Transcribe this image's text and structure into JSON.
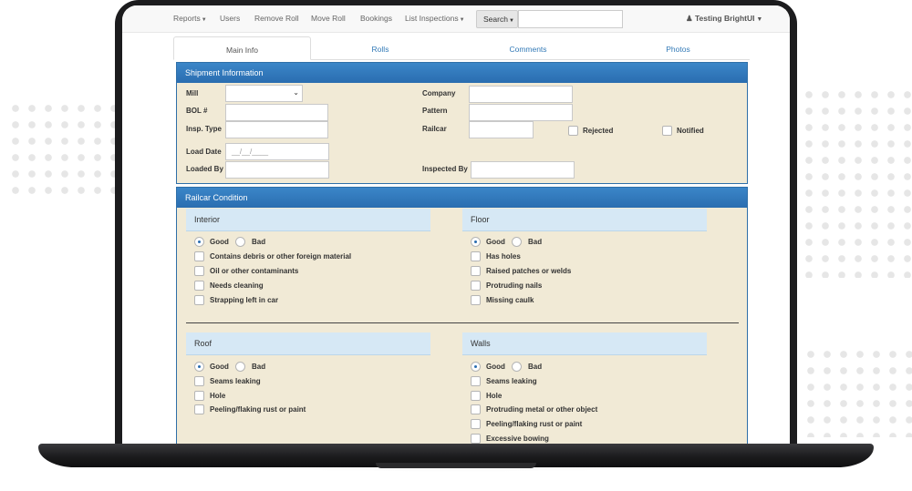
{
  "navbar": {
    "items": [
      {
        "label": "Reports",
        "dropdown": true
      },
      {
        "label": "Users",
        "dropdown": false
      },
      {
        "label": "Remove Roll",
        "dropdown": false
      },
      {
        "label": "Move Roll",
        "dropdown": false
      },
      {
        "label": "Bookings",
        "dropdown": false
      },
      {
        "label": "List Inspections",
        "dropdown": true
      }
    ],
    "search_label": "Search",
    "search_value": "",
    "user_label": "Testing BrightUI"
  },
  "tabs": [
    "Main Info",
    "Rolls",
    "Comments",
    "Photos"
  ],
  "active_tab": "Main Info",
  "shipment": {
    "title": "Shipment Information",
    "mill_label": "Mill",
    "mill_value": "",
    "bol_label": "BOL #",
    "insp_type_label": "Insp. Type",
    "load_date_label": "Load Date",
    "load_date_placeholder": "__/__/____",
    "loaded_by_label": "Loaded By",
    "company_label": "Company",
    "pattern_label": "Pattern",
    "railcar_label": "Railcar",
    "rejected_label": "Rejected",
    "notified_label": "Notified",
    "inspected_by_label": "Inspected By"
  },
  "railcar": {
    "title": "Railcar Condition",
    "good_label": "Good",
    "bad_label": "Bad",
    "interior": {
      "title": "Interior",
      "selected": "Good",
      "items": [
        "Contains debris or other foreign material",
        "Oil or other contaminants",
        "Needs cleaning",
        "Strapping left in car"
      ]
    },
    "floor": {
      "title": "Floor",
      "selected": "Good",
      "items": [
        "Has holes",
        "Raised patches or welds",
        "Protruding nails",
        "Missing caulk"
      ]
    },
    "roof": {
      "title": "Roof",
      "selected": "Good",
      "items": [
        "Seams leaking",
        "Hole",
        "Peeling/flaking rust or paint"
      ]
    },
    "walls": {
      "title": "Walls",
      "selected": "Good",
      "items": [
        "Seams leaking",
        "Hole",
        "Protruding metal or other object",
        "Peeling/flaking rust or paint",
        "Excessive bowing"
      ]
    }
  },
  "colors": {
    "panel_header": "#2a6db0",
    "panel_body": "#f1ead6",
    "section_header": "#d6e8f5",
    "link": "#337ab7"
  }
}
